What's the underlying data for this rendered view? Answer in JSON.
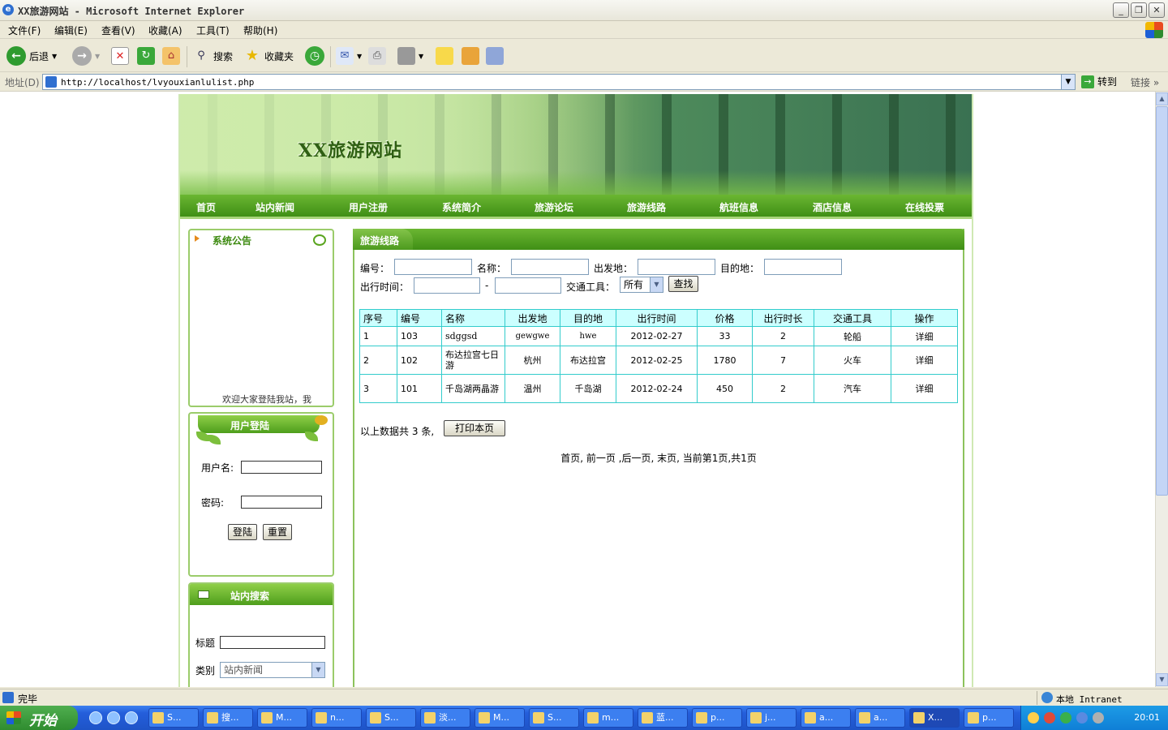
{
  "window": {
    "title": "XX旅游网站 - Microsoft Internet Explorer",
    "controls": {
      "minimize": "_",
      "maximize": "❐",
      "close": "✕"
    }
  },
  "menu": [
    "文件(F)",
    "编辑(E)",
    "查看(V)",
    "收藏(A)",
    "工具(T)",
    "帮助(H)"
  ],
  "toolbar": {
    "back": "后退",
    "search": "搜索",
    "favorites": "收藏夹"
  },
  "address": {
    "label": "地址(D)",
    "url": "http://localhost/lvyouxianlulist.php",
    "go": "转到",
    "links": "链接"
  },
  "site": {
    "name": "XX旅游网站",
    "nav": [
      "首页",
      "站内新闻",
      "用户注册",
      "系统简介",
      "旅游论坛",
      "旅游线路",
      "航班信息",
      "酒店信息",
      "在线投票"
    ]
  },
  "notice": {
    "title": "系统公告",
    "marquee": "欢迎大家登陆我站，我"
  },
  "login": {
    "title": "用户登陆",
    "username_label": "用户名:",
    "password_label": "密码:",
    "login_button": "登陆",
    "reset_button": "重置"
  },
  "site_search": {
    "title": "站内搜索",
    "title_label": "标题",
    "category_label": "类别",
    "category_value": "站内新闻"
  },
  "main": {
    "title": "旅游线路",
    "filters": {
      "code_label": "编号：",
      "name_label": "名称：",
      "from_label": "出发地：",
      "to_label": "目的地：",
      "date_label": "出行时间：",
      "date_sep": "-",
      "transport_label": "交通工具：",
      "transport_value": "所有",
      "search_button": "查找"
    },
    "table": {
      "headers": [
        "序号",
        "编号",
        "名称",
        "出发地",
        "目的地",
        "出行时间",
        "价格",
        "出行时长",
        "交通工具",
        "操作"
      ],
      "rows": [
        [
          "1",
          "103",
          "sdggsd",
          "gewgwe",
          "hwe",
          "2012-02-27",
          "33",
          "2",
          "轮船",
          "详细"
        ],
        [
          "2",
          "102",
          "布达拉宫七日游",
          "杭州",
          "布达拉宫",
          "2012-02-25",
          "1780",
          "7",
          "火车",
          "详细"
        ],
        [
          "3",
          "101",
          "千岛湖两晶游",
          "温州",
          "千岛湖",
          "2012-02-24",
          "450",
          "2",
          "汽车",
          "详细"
        ]
      ]
    },
    "summary": {
      "prefix": "以上数据共",
      "count": "3",
      "suffix": "条,",
      "print_button": "打印本页"
    },
    "pager": "首页, 前一页 ,后一页, 末页, 当前第1页,共1页"
  },
  "statusbar": {
    "status": "完毕",
    "zone": "本地 Intranet"
  },
  "taskbar": {
    "start": "开始",
    "tasks": [
      "S...",
      "搜...",
      "M...",
      "n...",
      "S...",
      "淡...",
      "M...",
      "S...",
      "m...",
      "蓝...",
      "p...",
      "j...",
      "a...",
      "a...",
      "X...",
      "p..."
    ],
    "clock": "20:01"
  }
}
